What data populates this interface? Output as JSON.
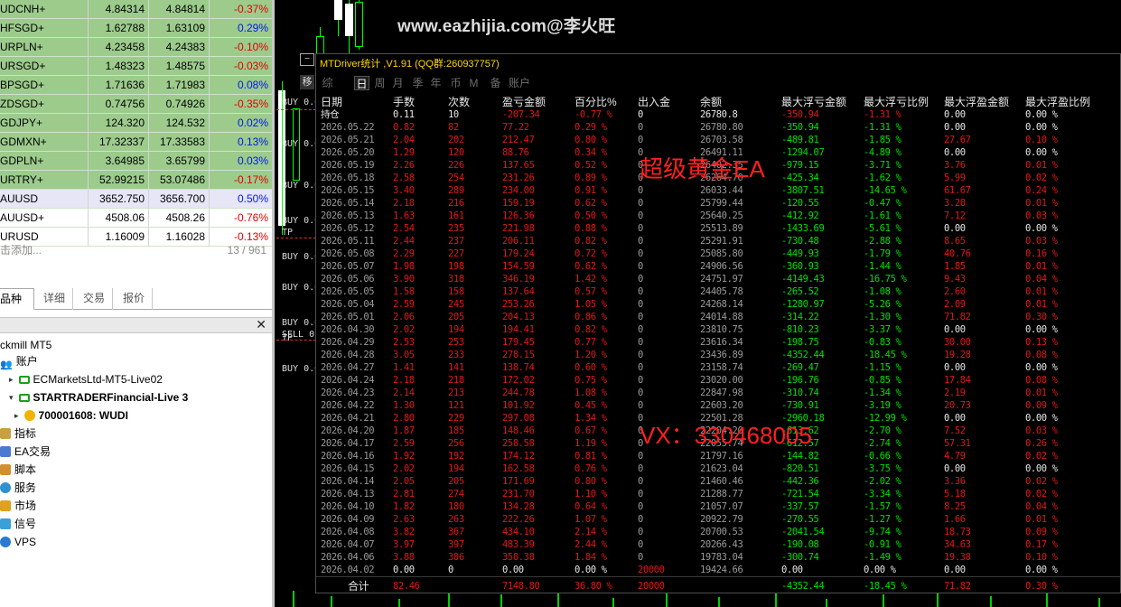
{
  "quotes": [
    {
      "symbol": "UDCNH+",
      "bid": "4.84314",
      "ask": "4.84814",
      "change": "-0.37%",
      "dir": "neg",
      "row": "green"
    },
    {
      "symbol": "HFSGD+",
      "bid": "1.62788",
      "ask": "1.63109",
      "change": "0.29%",
      "dir": "pos",
      "row": "green"
    },
    {
      "symbol": "URPLN+",
      "bid": "4.23458",
      "ask": "4.24383",
      "change": "-0.10%",
      "dir": "neg",
      "row": "green"
    },
    {
      "symbol": "URSGD+",
      "bid": "1.48323",
      "ask": "1.48575",
      "change": "-0.03%",
      "dir": "neg",
      "row": "green"
    },
    {
      "symbol": "BPSGD+",
      "bid": "1.71636",
      "ask": "1.71983",
      "change": "0.08%",
      "dir": "pos",
      "row": "green"
    },
    {
      "symbol": "ZDSGD+",
      "bid": "0.74756",
      "ask": "0.74926",
      "change": "-0.35%",
      "dir": "neg",
      "row": "green"
    },
    {
      "symbol": "GDJPY+",
      "bid": "124.320",
      "ask": "124.532",
      "change": "0.02%",
      "dir": "pos",
      "row": "green"
    },
    {
      "symbol": "GDMXN+",
      "bid": "17.32337",
      "ask": "17.33583",
      "change": "0.13%",
      "dir": "pos",
      "row": "green"
    },
    {
      "symbol": "GDPLN+",
      "bid": "3.64985",
      "ask": "3.65799",
      "change": "0.03%",
      "dir": "pos",
      "row": "green"
    },
    {
      "symbol": "URTRY+",
      "bid": "52.99215",
      "ask": "53.07486",
      "change": "-0.17%",
      "dir": "neg",
      "row": "green"
    },
    {
      "symbol": "AUUSD",
      "bid": "3652.750",
      "ask": "3656.700",
      "change": "0.50%",
      "dir": "pos",
      "row": "sel"
    },
    {
      "symbol": "AUUSD+",
      "bid": "4508.06",
      "ask": "4508.26",
      "change": "-0.76%",
      "dir": "neg",
      "row": "white"
    },
    {
      "symbol": "URUSD",
      "bid": "1.16009",
      "ask": "1.16028",
      "change": "-0.13%",
      "dir": "neg",
      "row": "white"
    }
  ],
  "add_label": "击添加...",
  "symbol_count": "13 / 961",
  "bottom_tabs": [
    "品种",
    "详细",
    "交易",
    "报价"
  ],
  "tree": {
    "root": "ckmill MT5",
    "account": "账户",
    "server1": "ECMarketsLtd-MT5-Live02",
    "server2": "STARTRADERFinancial-Live 3",
    "user": "700001608: WUDI",
    "items": [
      "指标",
      "EA交易",
      "脚本",
      "服务",
      "市场",
      "信号",
      "VPS"
    ]
  },
  "watermark": "www.eazhijia.com@李火旺",
  "order_labels": [
    "BUY 0.0",
    "BUY 0.0",
    "BUY 0.0",
    "BUY 0.0",
    "TP",
    "BUY 0.0",
    "BUY 0.0",
    "BUY 0.0",
    "SELL 0",
    "TP",
    "BUY 0.0"
  ],
  "panel": {
    "title": "MTDriver统计 ,V1.91 (QQ群:260937757)",
    "tabs": [
      "综",
      "日",
      "周",
      "月",
      "季",
      "年",
      "币",
      "M",
      "备",
      "账户"
    ],
    "active_tab": "日",
    "headers": [
      "日期",
      "手数",
      "次数",
      "盈亏金额",
      "百分比%",
      "出入金",
      "余额",
      "最大浮亏金额",
      "最大浮亏比例",
      "最大浮盈金额",
      "最大浮盈比例"
    ],
    "position_row": [
      "持仓",
      "0.11",
      "10",
      "-207.34",
      "-0.77 %",
      "0",
      "26780.8",
      "-350.94",
      "-1.31 %",
      "0.00",
      "0.00 %"
    ],
    "rows": [
      [
        "2026.05.22",
        "0.82",
        "82",
        "77.22",
        "0.29 %",
        "0",
        "26780.80",
        "-350.94",
        "-1.31 %",
        "0.00",
        "0.00 %"
      ],
      [
        "2026.05.21",
        "2.04",
        "202",
        "212.47",
        "0.80 %",
        "0",
        "26703.58",
        "-489.81",
        "-1.85 %",
        "27.67",
        "0.10 %"
      ],
      [
        "2026.05.20",
        "1.29",
        "120",
        "88.76",
        "0.34 %",
        "0",
        "26491.11",
        "-1294.07",
        "-4.89 %",
        "0.00",
        "0.00 %"
      ],
      [
        "2026.05.19",
        "2.26",
        "226",
        "137.65",
        "0.52 %",
        "0",
        "26402.35",
        "-979.15",
        "-3.71 %",
        "3.76",
        "0.01 %"
      ],
      [
        "2026.05.18",
        "2.58",
        "254",
        "231.26",
        "0.89 %",
        "0",
        "26264.70",
        "-425.34",
        "-1.62 %",
        "5.99",
        "0.02 %"
      ],
      [
        "2026.05.15",
        "3.40",
        "289",
        "234.00",
        "0.91 %",
        "0",
        "26033.44",
        "-3807.51",
        "-14.65 %",
        "61.67",
        "0.24 %"
      ],
      [
        "2026.05.14",
        "2.18",
        "216",
        "159.19",
        "0.62 %",
        "0",
        "25799.44",
        "-120.55",
        "-0.47 %",
        "3.28",
        "0.01 %"
      ],
      [
        "2026.05.13",
        "1.63",
        "161",
        "126.36",
        "0.50 %",
        "0",
        "25640.25",
        "-412.92",
        "-1.61 %",
        "7.12",
        "0.03 %"
      ],
      [
        "2026.05.12",
        "2.54",
        "235",
        "221.98",
        "0.88 %",
        "0",
        "25513.89",
        "-1433.69",
        "-5.61 %",
        "0.00",
        "0.00 %"
      ],
      [
        "2026.05.11",
        "2.44",
        "237",
        "206.11",
        "0.82 %",
        "0",
        "25291.91",
        "-730.48",
        "-2.88 %",
        "8.65",
        "0.03 %"
      ],
      [
        "2026.05.08",
        "2.29",
        "227",
        "179.24",
        "0.72 %",
        "0",
        "25085.80",
        "-449.93",
        "-1.79 %",
        "40.76",
        "0.16 %"
      ],
      [
        "2026.05.07",
        "1.98",
        "198",
        "154.59",
        "0.62 %",
        "0",
        "24906.56",
        "-360.93",
        "-1.44 %",
        "1.85",
        "0.01 %"
      ],
      [
        "2026.05.06",
        "3.90",
        "318",
        "346.19",
        "1.42 %",
        "0",
        "24751.97",
        "-4149.43",
        "-16.75 %",
        "9.43",
        "0.04 %"
      ],
      [
        "2026.05.05",
        "1.58",
        "158",
        "137.64",
        "0.57 %",
        "0",
        "24405.78",
        "-265.52",
        "-1.08 %",
        "2.60",
        "0.01 %"
      ],
      [
        "2026.05.04",
        "2.59",
        "245",
        "253.26",
        "1.05 %",
        "0",
        "24268.14",
        "-1280.97",
        "-5.26 %",
        "2.09",
        "0.01 %"
      ],
      [
        "2026.05.01",
        "2.06",
        "205",
        "204.13",
        "0.86 %",
        "0",
        "24014.88",
        "-314.22",
        "-1.30 %",
        "71.82",
        "0.30 %"
      ],
      [
        "2026.04.30",
        "2.02",
        "194",
        "194.41",
        "0.82 %",
        "0",
        "23810.75",
        "-810.23",
        "-3.37 %",
        "0.00",
        "0.00 %"
      ],
      [
        "2026.04.29",
        "2.53",
        "253",
        "179.45",
        "0.77 %",
        "0",
        "23616.34",
        "-198.75",
        "-0.83 %",
        "30.00",
        "0.13 %"
      ],
      [
        "2026.04.28",
        "3.05",
        "233",
        "278.15",
        "1.20 %",
        "0",
        "23436.89",
        "-4352.44",
        "-18.45 %",
        "19.28",
        "0.08 %"
      ],
      [
        "2026.04.27",
        "1.41",
        "141",
        "138.74",
        "0.60 %",
        "0",
        "23158.74",
        "-269.47",
        "-1.15 %",
        "0.00",
        "0.00 %"
      ],
      [
        "2026.04.24",
        "2.18",
        "218",
        "172.02",
        "0.75 %",
        "0",
        "23020.00",
        "-196.76",
        "-0.85 %",
        "17.84",
        "0.08 %"
      ],
      [
        "2026.04.23",
        "2.14",
        "213",
        "244.78",
        "1.08 %",
        "0",
        "22847.98",
        "-310.74",
        "-1.34 %",
        "2.19",
        "0.01 %"
      ],
      [
        "2026.04.22",
        "1.30",
        "121",
        "101.92",
        "0.45 %",
        "0",
        "22603.20",
        "-730.91",
        "-3.19 %",
        "20.73",
        "0.09 %"
      ],
      [
        "2026.04.21",
        "2.80",
        "229",
        "297.08",
        "1.34 %",
        "0",
        "22501.28",
        "-2960.18",
        "-12.99 %",
        "0.00",
        "0.00 %"
      ],
      [
        "2026.04.20",
        "1.87",
        "185",
        "148.46",
        "0.67 %",
        "0",
        "22204.20",
        "-613.62",
        "-2.70 %",
        "7.52",
        "0.03 %"
      ],
      [
        "2026.04.17",
        "2.59",
        "256",
        "258.58",
        "1.19 %",
        "0",
        "22055.74",
        "-612.57",
        "-2.74 %",
        "57.31",
        "0.26 %"
      ],
      [
        "2026.04.16",
        "1.92",
        "192",
        "174.12",
        "0.81 %",
        "0",
        "21797.16",
        "-144.82",
        "-0.66 %",
        "4.79",
        "0.02 %"
      ],
      [
        "2026.04.15",
        "2.02",
        "194",
        "162.58",
        "0.76 %",
        "0",
        "21623.04",
        "-820.51",
        "-3.75 %",
        "0.00",
        "0.00 %"
      ],
      [
        "2026.04.14",
        "2.05",
        "205",
        "171.69",
        "0.80 %",
        "0",
        "21460.46",
        "-442.36",
        "-2.02 %",
        "3.36",
        "0.02 %"
      ],
      [
        "2026.04.13",
        "2.81",
        "274",
        "231.70",
        "1.10 %",
        "0",
        "21288.77",
        "-721.54",
        "-3.34 %",
        "5.18",
        "0.02 %"
      ],
      [
        "2026.04.10",
        "1.82",
        "180",
        "134.28",
        "0.64 %",
        "0",
        "21057.07",
        "-337.57",
        "-1.57 %",
        "8.25",
        "0.04 %"
      ],
      [
        "2026.04.09",
        "2.63",
        "263",
        "222.26",
        "1.07 %",
        "0",
        "20922.79",
        "-270.55",
        "-1.27 %",
        "1.66",
        "0.01 %"
      ],
      [
        "2026.04.08",
        "3.82",
        "367",
        "434.10",
        "2.14 %",
        "0",
        "20700.53",
        "-2041.54",
        "-9.74 %",
        "18.73",
        "0.09 %"
      ],
      [
        "2026.04.07",
        "3.97",
        "397",
        "483.39",
        "2.44 %",
        "0",
        "20266.43",
        "-190.08",
        "-0.91 %",
        "34.63",
        "0.17 %"
      ],
      [
        "2026.04.06",
        "3.88",
        "386",
        "358.38",
        "1.84 %",
        "0",
        "19783.04",
        "-300.74",
        "-1.49 %",
        "19.38",
        "0.10 %"
      ],
      [
        "2026.04.02",
        "0.00",
        "0",
        "0.00",
        "0.00 %",
        "20000",
        "19424.66",
        "0.00",
        "0.00 %",
        "0.00",
        "0.00 %"
      ]
    ],
    "total_row": [
      "合计",
      "82.46",
      "",
      "7148.80",
      "36.80 %",
      "20000",
      "",
      "-4352.44",
      "-18.45 %",
      "71.82",
      "0.30 %"
    ]
  },
  "overlay_texts": [
    "超级黄金EA",
    "VX：330468005"
  ],
  "colors": {
    "accent_green": "#9ccb8c",
    "positive": "#0018e8",
    "negative": "#e00000"
  }
}
